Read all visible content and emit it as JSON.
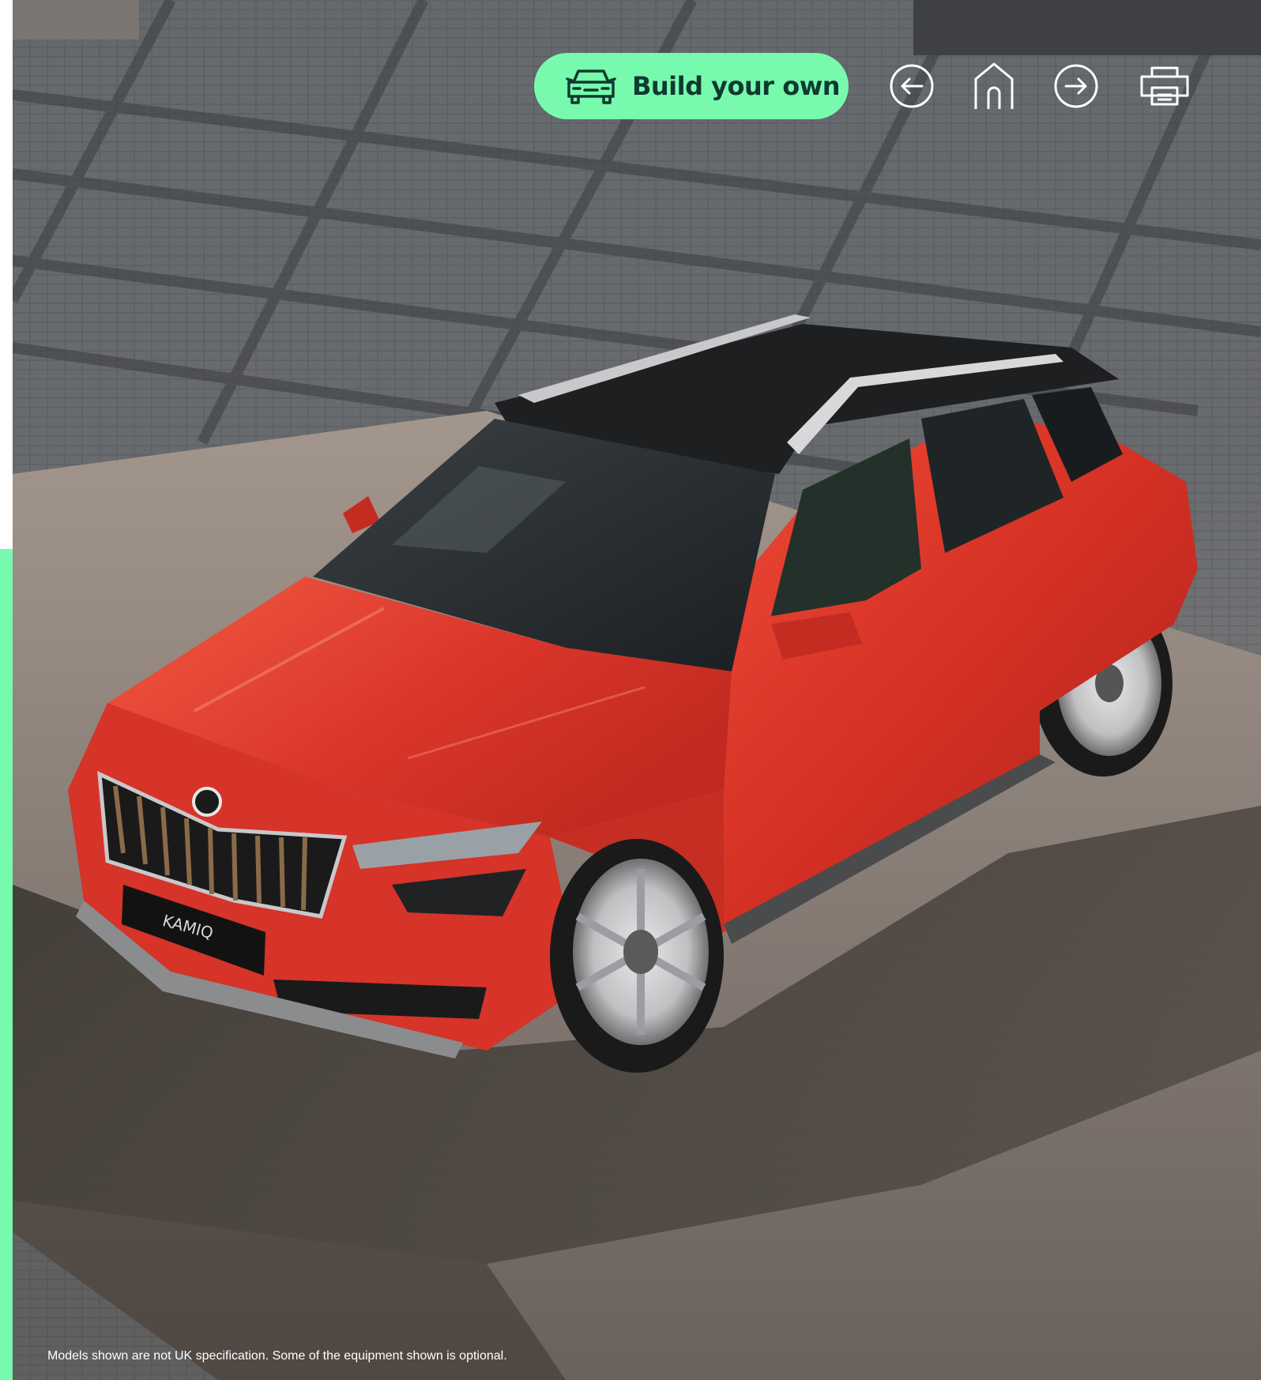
{
  "toolbar": {
    "build_label": "Build your own",
    "build_icon": "car-front-icon",
    "back_icon": "arrow-left-circle-icon",
    "home_icon": "home-icon",
    "forward_icon": "arrow-right-circle-icon",
    "print_icon": "printer-icon"
  },
  "car": {
    "plate_text": "KAMIQ"
  },
  "footer": {
    "disclaimer": "Models shown are not UK specification. Some of the equipment shown is optional."
  },
  "colors": {
    "accent": "#78faae",
    "accent_text": "#0e3a2f",
    "car_body": "#d8352a",
    "ground": "#9a9088",
    "paving": "#55585c"
  }
}
